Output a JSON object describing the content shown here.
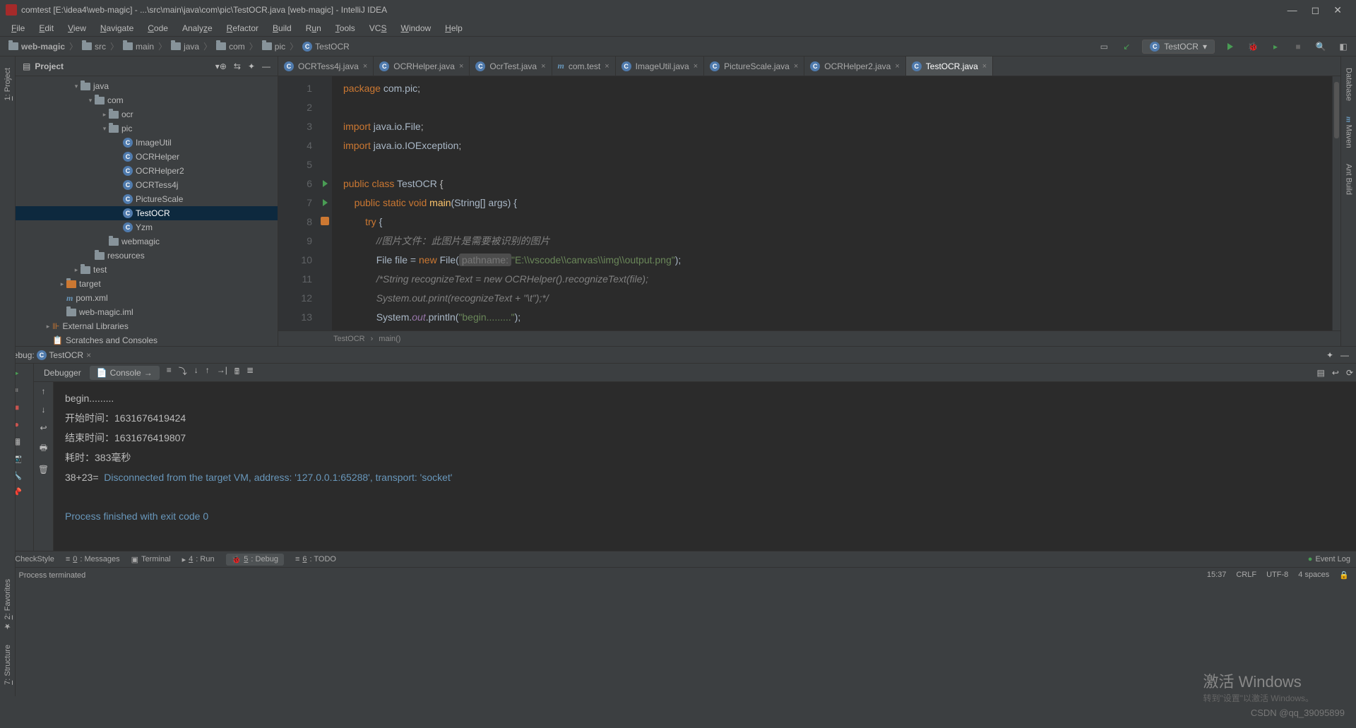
{
  "window": {
    "title": "comtest [E:\\idea4\\web-magic] - ...\\src\\main\\java\\com\\pic\\TestOCR.java [web-magic] - IntelliJ IDEA"
  },
  "menu": [
    "File",
    "Edit",
    "View",
    "Navigate",
    "Code",
    "Analyze",
    "Refactor",
    "Build",
    "Run",
    "Tools",
    "VCS",
    "Window",
    "Help"
  ],
  "breadcrumbs": [
    "web-magic",
    "src",
    "main",
    "java",
    "com",
    "pic",
    "TestOCR"
  ],
  "runConfig": "TestOCR",
  "projectTool": {
    "title": "Project"
  },
  "tree": [
    {
      "depth": 0,
      "arrow": "▾",
      "icon": "folder",
      "label": "java"
    },
    {
      "depth": 1,
      "arrow": "▾",
      "icon": "folder",
      "label": "com"
    },
    {
      "depth": 2,
      "arrow": "▸",
      "icon": "folder",
      "label": "ocr"
    },
    {
      "depth": 2,
      "arrow": "▾",
      "icon": "folder",
      "label": "pic"
    },
    {
      "depth": 3,
      "arrow": "",
      "icon": "class",
      "label": "ImageUtil"
    },
    {
      "depth": 3,
      "arrow": "",
      "icon": "class",
      "label": "OCRHelper"
    },
    {
      "depth": 3,
      "arrow": "",
      "icon": "class",
      "label": "OCRHelper2"
    },
    {
      "depth": 3,
      "arrow": "",
      "icon": "class",
      "label": "OCRTess4j"
    },
    {
      "depth": 3,
      "arrow": "",
      "icon": "class",
      "label": "PictureScale"
    },
    {
      "depth": 3,
      "arrow": "",
      "icon": "class",
      "label": "TestOCR",
      "selected": true
    },
    {
      "depth": 3,
      "arrow": "",
      "icon": "class",
      "label": "Yzm"
    },
    {
      "depth": 2,
      "arrow": "",
      "icon": "folder",
      "label": "webmagic"
    },
    {
      "depth": 1,
      "arrow": "",
      "icon": "folder",
      "label": "resources"
    },
    {
      "depth": 0,
      "arrow": "▸",
      "icon": "folder",
      "label": "test"
    },
    {
      "depth": -1,
      "arrow": "▸",
      "icon": "folder",
      "label": "target",
      "orange": true
    },
    {
      "depth": -1,
      "arrow": "",
      "icon": "m",
      "label": "pom.xml"
    },
    {
      "depth": -1,
      "arrow": "",
      "icon": "file",
      "label": "web-magic.iml"
    },
    {
      "depth": -2,
      "arrow": "▸",
      "icon": "lib",
      "label": "External Libraries"
    },
    {
      "depth": -2,
      "arrow": "",
      "icon": "scratch",
      "label": "Scratches and Consoles"
    }
  ],
  "tabs": [
    {
      "icon": "class",
      "label": "OCRTess4j.java"
    },
    {
      "icon": "class",
      "label": "OCRHelper.java"
    },
    {
      "icon": "class",
      "label": "OcrTest.java"
    },
    {
      "icon": "m",
      "label": "com.test"
    },
    {
      "icon": "class",
      "label": "ImageUtil.java"
    },
    {
      "icon": "class",
      "label": "PictureScale.java"
    },
    {
      "icon": "class",
      "label": "OCRHelper2.java"
    },
    {
      "icon": "class",
      "label": "TestOCR.java",
      "active": true
    }
  ],
  "code": {
    "lines": [
      1,
      2,
      3,
      4,
      5,
      6,
      7,
      8,
      9,
      10,
      11,
      12,
      13
    ],
    "l1_a": "package ",
    "l1_b": "com.pic",
    "l3_a": "import ",
    "l3_b": "java.io.File",
    "l4_a": "import ",
    "l4_b": "java.io.IOException",
    "l6_a": "public class ",
    "l6_b": "TestOCR",
    " l6_c": " {",
    "l7_a": "public static void ",
    "l7_b": "main",
    "l7_c": "(String[] args) {",
    "l8_a": "try ",
    "l8_b": "{",
    "l9": "//图片文件：此图片是需要被识别的图片",
    "l10_a": "File file = ",
    "l10_b": "new ",
    "l10_c": "File(",
    "l10_hint": "pathname:",
    "l10_d": "\"E:\\\\vscode\\\\canvas\\\\img\\\\output.png\"",
    "l10_e": ");",
    "l11": "/*String recognizeText = new OCRHelper().recognizeText(file);",
    "l12": "System.out.print(recognizeText + \"\\t\");*/",
    "l13_a": "System.",
    "l13_b": "out",
    "l13_c": ".println(",
    "l13_d": "\"begin.........\"",
    "l13_e": ");"
  },
  "editorCrumbs": [
    "TestOCR",
    "main()"
  ],
  "debug": {
    "title": "Debug:",
    "config": "TestOCR",
    "tabs": {
      "debugger": "Debugger",
      "console": "Console"
    }
  },
  "console": {
    "l1": "begin.........",
    "l2": "开始时间：1631676419424",
    "l3": "结束时间：1631676419807",
    "l4": "耗时：383毫秒",
    "l5_a": "38+23=  ",
    "l5_b": "Disconnected from the target VM, address: '127.0.0.1:65288', transport: 'socket'",
    "l6": "Process finished with exit code 0"
  },
  "bottomBar": [
    "CheckStyle",
    "0: Messages",
    "Terminal",
    "4: Run",
    "5: Debug",
    "6: TODO"
  ],
  "eventLog": "Event Log",
  "statusBar": {
    "msg": "Process terminated",
    "time": "15:37",
    "eol": "CRLF",
    "enc": "UTF-8",
    "spaces": "4 spaces"
  },
  "watermark": {
    "big": "激活 Windows",
    "small": "转到\"设置\"以激活 Windows。"
  },
  "csdn": "CSDN @qq_39095899"
}
